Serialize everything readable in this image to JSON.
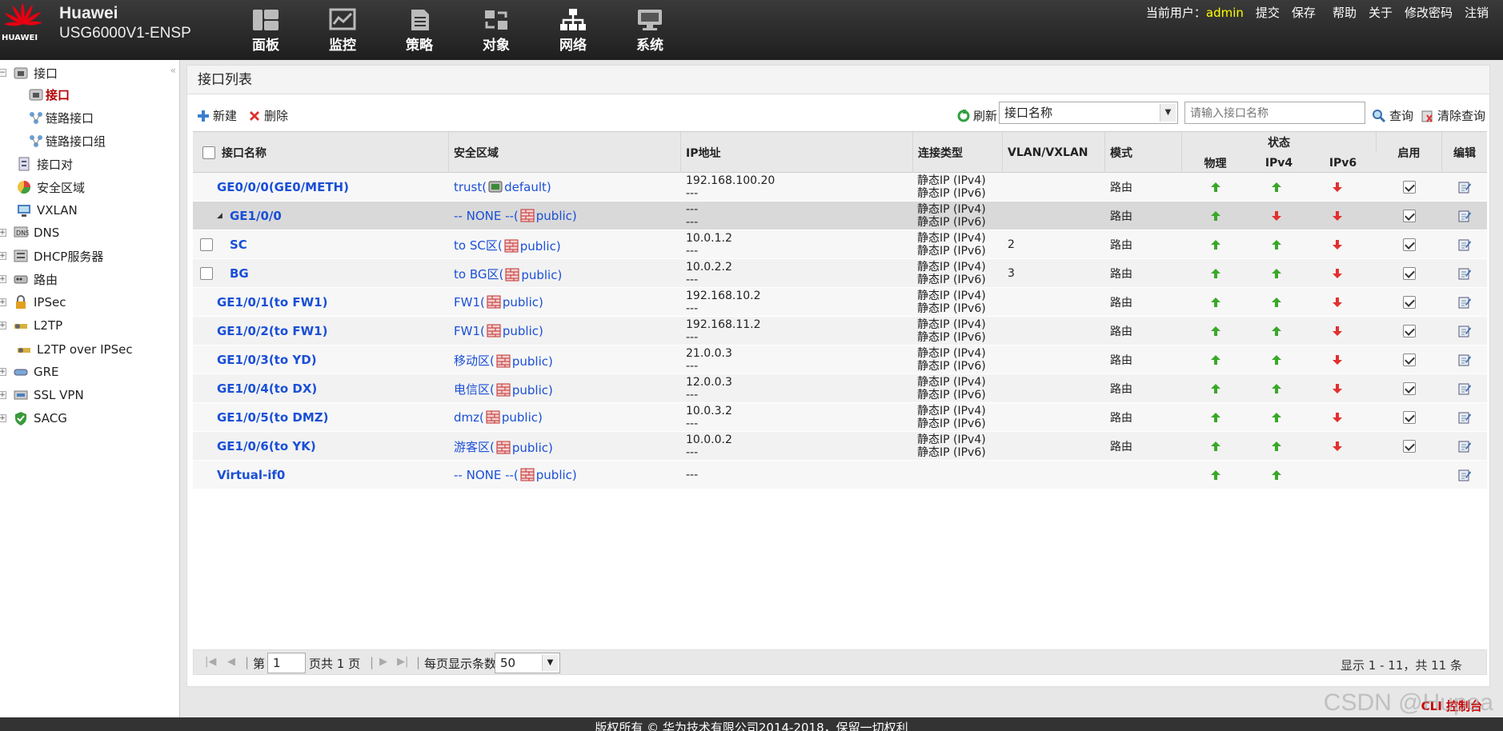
{
  "header": {
    "logo_text": "HUAWEI",
    "brand_line1": "Huawei",
    "brand_line2": "USG6000V1-ENSP",
    "nav": [
      {
        "label": "面板",
        "icon": "dashboard-icon"
      },
      {
        "label": "监控",
        "icon": "monitor-chart-icon"
      },
      {
        "label": "策略",
        "icon": "policy-document-icon"
      },
      {
        "label": "对象",
        "icon": "object-icon"
      },
      {
        "label": "网络",
        "icon": "network-topology-icon"
      },
      {
        "label": "系统",
        "icon": "system-computer-icon"
      }
    ],
    "user_label": "当前用户：",
    "user_name": "admin",
    "links": [
      "提交",
      "保存",
      "帮助",
      "关于",
      "修改密码",
      "注销"
    ]
  },
  "sidebar": {
    "collapse": "«",
    "items": [
      {
        "label": "接口",
        "icon": "interface-folder-icon",
        "expanded": true
      },
      {
        "label": "接口",
        "icon": "interface-icon",
        "selected": true
      },
      {
        "label": "链路接口",
        "icon": "link-interface-icon"
      },
      {
        "label": "链路接口组",
        "icon": "link-interface-group-icon"
      },
      {
        "label": "接口对",
        "icon": "interface-pair-icon"
      },
      {
        "label": "安全区域",
        "icon": "security-zone-icon"
      },
      {
        "label": "VXLAN",
        "icon": "vxlan-icon"
      },
      {
        "label": "DNS",
        "icon": "dns-icon"
      },
      {
        "label": "DHCP服务器",
        "icon": "dhcp-server-icon"
      },
      {
        "label": "路由",
        "icon": "route-icon"
      },
      {
        "label": "IPSec",
        "icon": "ipsec-lock-icon"
      },
      {
        "label": "L2TP",
        "icon": "l2tp-icon"
      },
      {
        "label": "L2TP over IPSec",
        "icon": "l2tp-over-ipsec-icon"
      },
      {
        "label": "GRE",
        "icon": "gre-icon"
      },
      {
        "label": "SSL VPN",
        "icon": "ssl-vpn-icon"
      },
      {
        "label": "SACG",
        "icon": "sacg-shield-icon"
      }
    ]
  },
  "panel": {
    "title": "接口列表",
    "toolbar": {
      "new_label": "新建",
      "delete_label": "删除",
      "refresh_label": "刷新",
      "search_field": "接口名称",
      "search_placeholder": "请输入接口名称",
      "query_label": "查询",
      "clear_label": "清除查询"
    },
    "columns": {
      "name": "接口名称",
      "zone": "安全区域",
      "ip": "IP地址",
      "conn": "连接类型",
      "vlan": "VLAN/VXLAN",
      "mode": "模式",
      "status": "状态",
      "physical": "物理",
      "ipv4": "IPv4",
      "ipv6": "IPv6",
      "enable": "启用",
      "edit": "编辑"
    },
    "rows": [
      {
        "name": "GE0/0/0(GE0/METH)",
        "zone": "trust(",
        "zone_vsys": "default)",
        "zone_icon": "default-vsys-icon",
        "ip1": "192.168.100.20",
        "ip2": "---",
        "conn1": "静态IP (IPv4)",
        "conn2": "静态IP (IPv6)",
        "vlan": "",
        "mode": "路由",
        "phy": "up",
        "v4": "up",
        "v6": "down",
        "enabled": true,
        "indent": 0,
        "checkbox": false
      },
      {
        "name": "GE1/0/0",
        "zone": "-- NONE --(",
        "zone_vsys": "public)",
        "zone_icon": "public-vsys-icon",
        "ip1": "---",
        "ip2": "---",
        "conn1": "静态IP (IPv4)",
        "conn2": "静态IP (IPv6)",
        "vlan": "",
        "mode": "路由",
        "phy": "up",
        "v4": "down",
        "v6": "down",
        "enabled": true,
        "indent": 0,
        "checkbox": false,
        "expander": "◢"
      },
      {
        "name": "SC",
        "zone": "to SC区(",
        "zone_vsys": "public)",
        "zone_icon": "public-vsys-icon",
        "ip1": "10.0.1.2",
        "ip2": "---",
        "conn1": "静态IP (IPv4)",
        "conn2": "静态IP (IPv6)",
        "vlan": "2",
        "mode": "路由",
        "phy": "up",
        "v4": "up",
        "v6": "down",
        "enabled": true,
        "indent": 1,
        "checkbox": true
      },
      {
        "name": "BG",
        "zone": "to BG区(",
        "zone_vsys": "public)",
        "zone_icon": "public-vsys-icon",
        "ip1": "10.0.2.2",
        "ip2": "---",
        "conn1": "静态IP (IPv4)",
        "conn2": "静态IP (IPv6)",
        "vlan": "3",
        "mode": "路由",
        "phy": "up",
        "v4": "up",
        "v6": "down",
        "enabled": true,
        "indent": 1,
        "checkbox": true
      },
      {
        "name": "GE1/0/1(to FW1)",
        "zone": "FW1(",
        "zone_vsys": "public)",
        "zone_icon": "public-vsys-icon",
        "ip1": "192.168.10.2",
        "ip2": "---",
        "conn1": "静态IP (IPv4)",
        "conn2": "静态IP (IPv6)",
        "vlan": "",
        "mode": "路由",
        "phy": "up",
        "v4": "up",
        "v6": "down",
        "enabled": true,
        "indent": 0,
        "checkbox": false
      },
      {
        "name": "GE1/0/2(to FW1)",
        "zone": "FW1(",
        "zone_vsys": "public)",
        "zone_icon": "public-vsys-icon",
        "ip1": "192.168.11.2",
        "ip2": "---",
        "conn1": "静态IP (IPv4)",
        "conn2": "静态IP (IPv6)",
        "vlan": "",
        "mode": "路由",
        "phy": "up",
        "v4": "up",
        "v6": "down",
        "enabled": true,
        "indent": 0,
        "checkbox": false
      },
      {
        "name": "GE1/0/3(to YD)",
        "zone": "移动区(",
        "zone_vsys": "public)",
        "zone_icon": "public-vsys-icon",
        "ip1": "21.0.0.3",
        "ip2": "---",
        "conn1": "静态IP (IPv4)",
        "conn2": "静态IP (IPv6)",
        "vlan": "",
        "mode": "路由",
        "phy": "up",
        "v4": "up",
        "v6": "down",
        "enabled": true,
        "indent": 0,
        "checkbox": false
      },
      {
        "name": "GE1/0/4(to DX)",
        "zone": "电信区(",
        "zone_vsys": "public)",
        "zone_icon": "public-vsys-icon",
        "ip1": "12.0.0.3",
        "ip2": "---",
        "conn1": "静态IP (IPv4)",
        "conn2": "静态IP (IPv6)",
        "vlan": "",
        "mode": "路由",
        "phy": "up",
        "v4": "up",
        "v6": "down",
        "enabled": true,
        "indent": 0,
        "checkbox": false
      },
      {
        "name": "GE1/0/5(to DMZ)",
        "zone": "dmz(",
        "zone_vsys": "public)",
        "zone_icon": "public-vsys-icon",
        "ip1": "10.0.3.2",
        "ip2": "---",
        "conn1": "静态IP (IPv4)",
        "conn2": "静态IP (IPv6)",
        "vlan": "",
        "mode": "路由",
        "phy": "up",
        "v4": "up",
        "v6": "down",
        "enabled": true,
        "indent": 0,
        "checkbox": false
      },
      {
        "name": "GE1/0/6(to YK)",
        "zone": "游客区(",
        "zone_vsys": "public)",
        "zone_icon": "public-vsys-icon",
        "ip1": "10.0.0.2",
        "ip2": "---",
        "conn1": "静态IP (IPv4)",
        "conn2": "静态IP (IPv6)",
        "vlan": "",
        "mode": "路由",
        "phy": "up",
        "v4": "up",
        "v6": "down",
        "enabled": true,
        "indent": 0,
        "checkbox": false
      },
      {
        "name": "Virtual-if0",
        "zone": "-- NONE --(",
        "zone_vsys": "public)",
        "zone_icon": "public-vsys-icon",
        "ip1": "---",
        "ip2": "",
        "conn1": "",
        "conn2": "",
        "vlan": "",
        "mode": "",
        "phy": "up",
        "v4": "up",
        "v6": "",
        "enabled": null,
        "indent": 0,
        "checkbox": false
      }
    ],
    "pager": {
      "page_prefix": "第",
      "page": "1",
      "page_suffix": "页共 1 页",
      "sep": "|",
      "per_page_label": "每页显示条数",
      "per_page": "50",
      "summary": "显示 1 - 11，共 11 条"
    }
  },
  "cli_label": "CLI 控制台",
  "footer": "版权所有 © 华为技术有限公司2014-2018，保留一切权利",
  "watermark": "CSDN @Hupea",
  "colors": {
    "up": "#3aa829",
    "down": "#e23030",
    "link": "#1a4fd6",
    "selected": "#b30000"
  }
}
